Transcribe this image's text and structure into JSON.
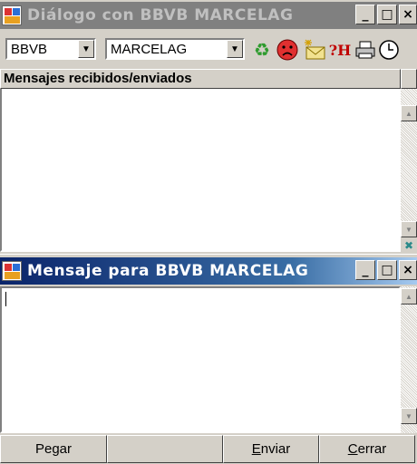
{
  "dialog_window": {
    "title": "Diálogo con BBVB MARCELAG",
    "controls": {
      "minimize": "_",
      "maximize": "□",
      "close": "×"
    },
    "toolbar": {
      "bank_select": "BBVB",
      "user_select": "MARCELAG",
      "icons": [
        "refresh-icon",
        "sad-face-icon",
        "new-mail-icon",
        "help-icon",
        "print-icon",
        "clock-icon"
      ],
      "help_label": "?H"
    },
    "list_header": "Mensajes recibidos/enviados",
    "messages": []
  },
  "message_window": {
    "title": "Mensaje para BBVB MARCELAG",
    "controls": {
      "minimize": "_",
      "maximize": "□",
      "close": "×"
    },
    "message_text": "",
    "buttons": {
      "paste": "Pegar",
      "send_prefix": "",
      "send_underlined": "E",
      "send_rest": "nviar",
      "close_prefix": "",
      "close_underlined": "C",
      "close_rest": "errar"
    }
  }
}
